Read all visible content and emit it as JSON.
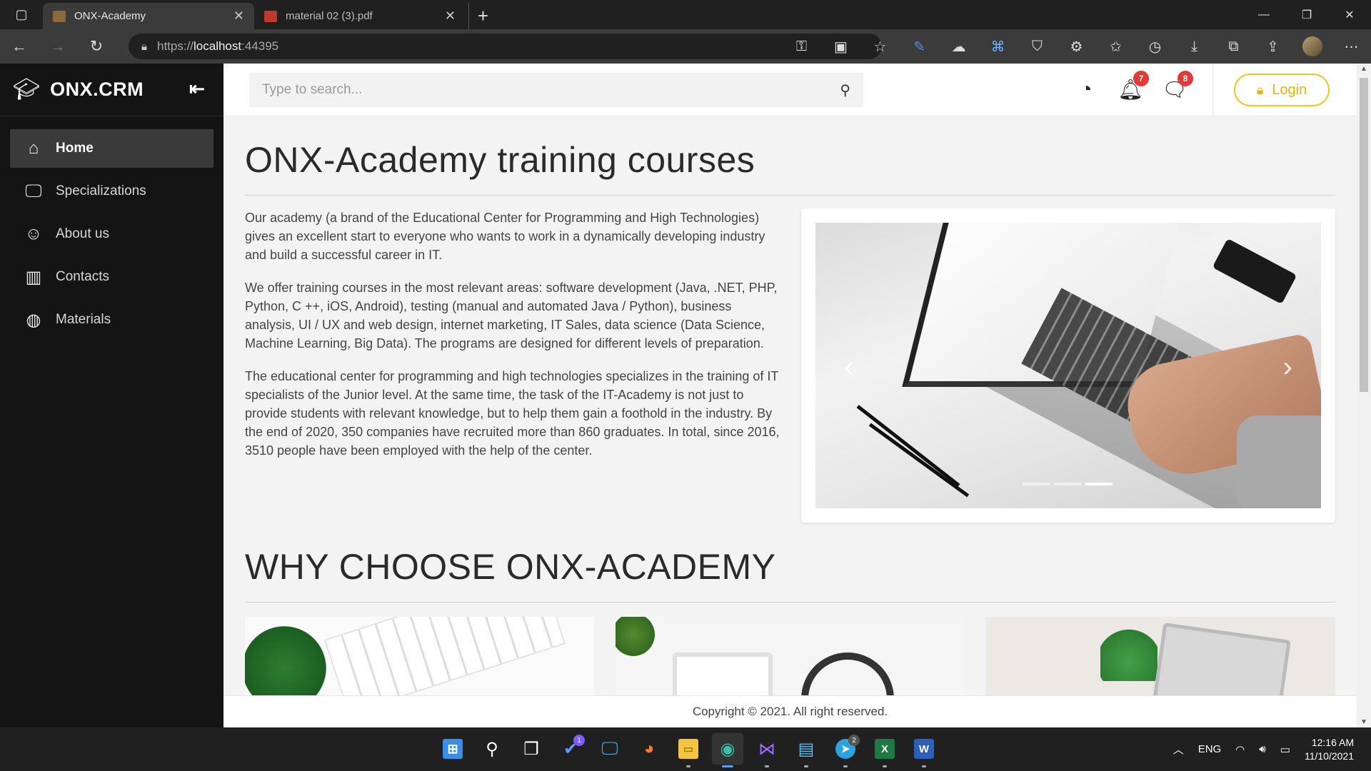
{
  "browser": {
    "tabs": [
      {
        "title": "ONX-Academy",
        "active": true
      },
      {
        "title": "material 02 (3).pdf",
        "active": false
      }
    ],
    "url_scheme": "https://",
    "url_host": "localhost",
    "url_port": ":44395"
  },
  "sidebar": {
    "brand": "ONX.CRM",
    "items": [
      {
        "label": "Home",
        "icon": "home-icon",
        "active": true
      },
      {
        "label": "Specializations",
        "icon": "specializations-icon",
        "active": false
      },
      {
        "label": "About us",
        "icon": "smiley-icon",
        "active": false
      },
      {
        "label": "Contacts",
        "icon": "map-icon",
        "active": false
      },
      {
        "label": "Materials",
        "icon": "palette-icon",
        "active": false
      }
    ]
  },
  "topbar": {
    "search_placeholder": "Type to search...",
    "notifications_count": "7",
    "messages_count": "8",
    "login_label": "Login"
  },
  "main": {
    "title": "ONX-Academy training courses",
    "paragraphs": [
      "Our academy (a brand of the Educational Center for Programming and High Technologies) gives an excellent start to everyone who wants to work in a dynamically developing industry and build a successful career in IT.",
      "We offer training courses in the most relevant areas: software development (Java, .NET, PHP, Python, C ++, iOS, Android), testing (manual and automated Java / Python), business analysis, UI / UX and web design, internet marketing, IT Sales, data science (Data Science, Machine Learning, Big Data). The programs are designed for different levels of preparation.",
      "The educational center for programming and high technologies specializes in the training of IT specialists of the Junior level. At the same time, the task of the IT-Academy is not just to provide students with relevant knowledge, but to help them gain a foothold in the industry. By the end of 2020, 350 companies have recruited more than 860 graduates. In total, since 2016, 3510 people have been employed with the help of the center."
    ],
    "carousel_active_index": 3,
    "carousel_total": 3,
    "why_title": "WHY CHOOSE ONX-ACADEMY"
  },
  "footer": {
    "copyright": "Copyright © 2021. All right reserved."
  },
  "taskbar": {
    "lang": "ENG",
    "time": "12:16 AM",
    "date": "11/10/2021",
    "todo_badge": "1",
    "telegram_badge": "2"
  },
  "colors": {
    "accent_login": "#f5c518",
    "badge_red": "#e53935",
    "sidebar_bg": "#141414"
  }
}
